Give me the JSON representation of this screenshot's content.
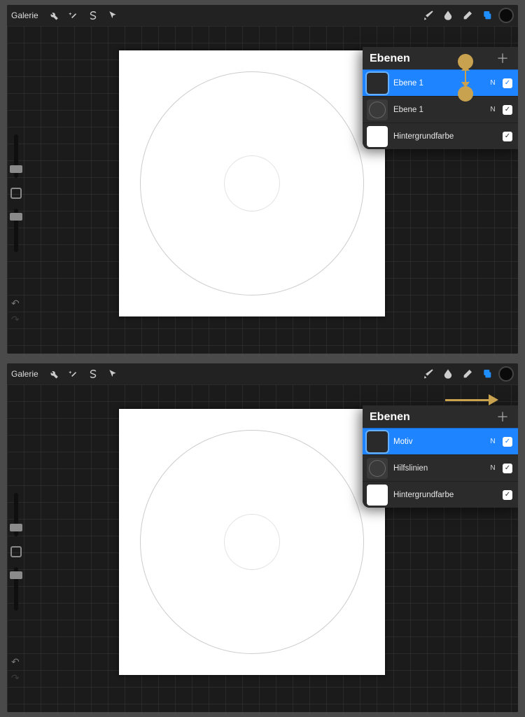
{
  "top": {
    "gallery": "Galerie",
    "layers_title": "Ebenen",
    "layers": [
      {
        "name": "Ebene 1",
        "blend": "N",
        "selected": true,
        "thumb": "dark"
      },
      {
        "name": "Ebene 1",
        "blend": "N",
        "selected": false,
        "thumb": "circle"
      },
      {
        "name": "Hintergrundfarbe",
        "blend": "",
        "selected": false,
        "thumb": "bg"
      }
    ],
    "annotation": "drag-down"
  },
  "bottom": {
    "gallery": "Galerie",
    "layers_title": "Ebenen",
    "layers": [
      {
        "name": "Motiv",
        "blend": "N",
        "selected": true,
        "thumb": "dark"
      },
      {
        "name": "Hilfslinien",
        "blend": "N",
        "selected": false,
        "thumb": "circle"
      },
      {
        "name": "Hintergrundfarbe",
        "blend": "",
        "selected": false,
        "thumb": "bg"
      }
    ],
    "annotation": "arrow-right"
  },
  "colors": {
    "accent": "#1f84ff",
    "annotation": "#c9a24f"
  }
}
